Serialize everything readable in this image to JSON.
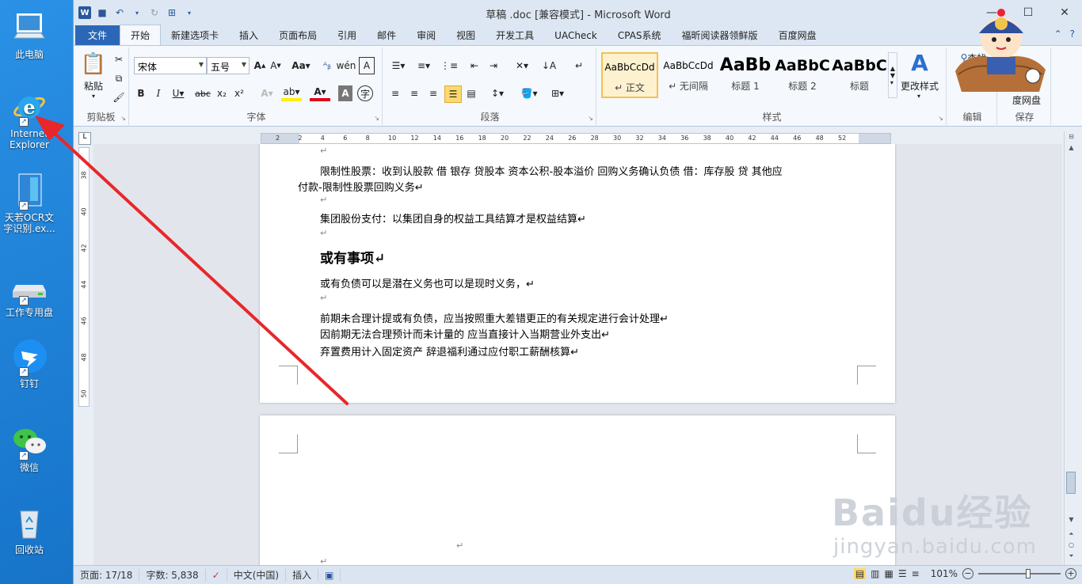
{
  "desktop": {
    "icons": [
      {
        "name": "this-pc",
        "label": "此电脑"
      },
      {
        "name": "internet-explorer",
        "label": "Internet Explorer"
      },
      {
        "name": "tianruo-ocr",
        "label": "天若OCR文字识别.ex..."
      },
      {
        "name": "work-disk",
        "label": "工作专用盘"
      },
      {
        "name": "dingtalk",
        "label": "钉钉"
      },
      {
        "name": "wechat",
        "label": "微信"
      },
      {
        "name": "recycle-bin",
        "label": "回收站"
      }
    ]
  },
  "word": {
    "title": "草稿 .doc [兼容模式]  -  Microsoft Word",
    "tabs": [
      "文件",
      "开始",
      "新建选项卡",
      "插入",
      "页面布局",
      "引用",
      "邮件",
      "审阅",
      "视图",
      "开发工具",
      "UACheck",
      "CPAS系统",
      "福昕阅读器领鲜版",
      "百度网盘"
    ],
    "active_tab": "开始",
    "ribbon": {
      "clipboard": {
        "label": "剪贴板",
        "paste": "粘贴"
      },
      "font": {
        "label": "字体",
        "font_name": "宋体",
        "font_size": "五号"
      },
      "paragraph": {
        "label": "段落"
      },
      "styles": {
        "label": "样式",
        "items": [
          {
            "sample": "AaBbCcDd",
            "name": "↵ 正文"
          },
          {
            "sample": "AaBbCcDd",
            "name": "↵ 无间隔"
          },
          {
            "sample": "AaBb",
            "name": "标题 1"
          },
          {
            "sample": "AaBbC",
            "name": "标题 2"
          },
          {
            "sample": "AaBbC",
            "name": "标题"
          }
        ],
        "change_styles": "更改样式"
      },
      "editing": {
        "label": "编辑",
        "find": "查找"
      },
      "save": {
        "label": "保存",
        "baidu": "度网盘"
      }
    },
    "ruler_numbers": [
      "2",
      "2",
      "4",
      "6",
      "8",
      "10",
      "12",
      "14",
      "16",
      "18",
      "20",
      "22",
      "24",
      "26",
      "28",
      "30",
      "32",
      "34",
      "36",
      "38",
      "40",
      "42",
      "44",
      "46",
      "48",
      "52"
    ],
    "vruler_numbers": [
      "38",
      "40",
      "42",
      "44",
      "46",
      "48",
      "50"
    ],
    "document": {
      "lines": [
        {
          "text": "↵",
          "type": "mark"
        },
        {
          "text": "限制性股票：收到认股款   借 银存   贷股本   资本公积-股本溢价    回购义务确认负债  借：库存股  贷  其他应",
          "type": "body"
        },
        {
          "text": "付款-限制性股票回购义务↵",
          "type": "body"
        },
        {
          "text": "↵",
          "type": "mark"
        },
        {
          "text": "集团股份支付：以集团自身的权益工具结算才是权益结算↵",
          "type": "body"
        },
        {
          "text": "↵",
          "type": "mark"
        },
        {
          "text": "或有事项↵",
          "type": "heading"
        },
        {
          "text": "或有负债可以是潜在义务也可以是现时义务，↵",
          "type": "body"
        },
        {
          "text": "↵",
          "type": "mark"
        },
        {
          "text": "前期未合理计提或有负债，应当按照重大差错更正的有关规定进行会计处理↵",
          "type": "body"
        },
        {
          "text": "因前期无法合理预计而未计量的    应当直接计入当期营业外支出↵",
          "type": "body"
        },
        {
          "text": "弃置费用计入固定资产    辞退福利通过应付职工薪酬核算↵",
          "type": "body"
        }
      ],
      "page2_marks": [
        "↵",
        "↵"
      ]
    },
    "status": {
      "page": "页面: 17/18",
      "words": "字数: 5,838",
      "language": "中文(中国)",
      "insert": "插入",
      "zoom": "101%"
    }
  },
  "watermark": {
    "brand": "Baidu经验",
    "url": "jingyan.baidu.com"
  }
}
